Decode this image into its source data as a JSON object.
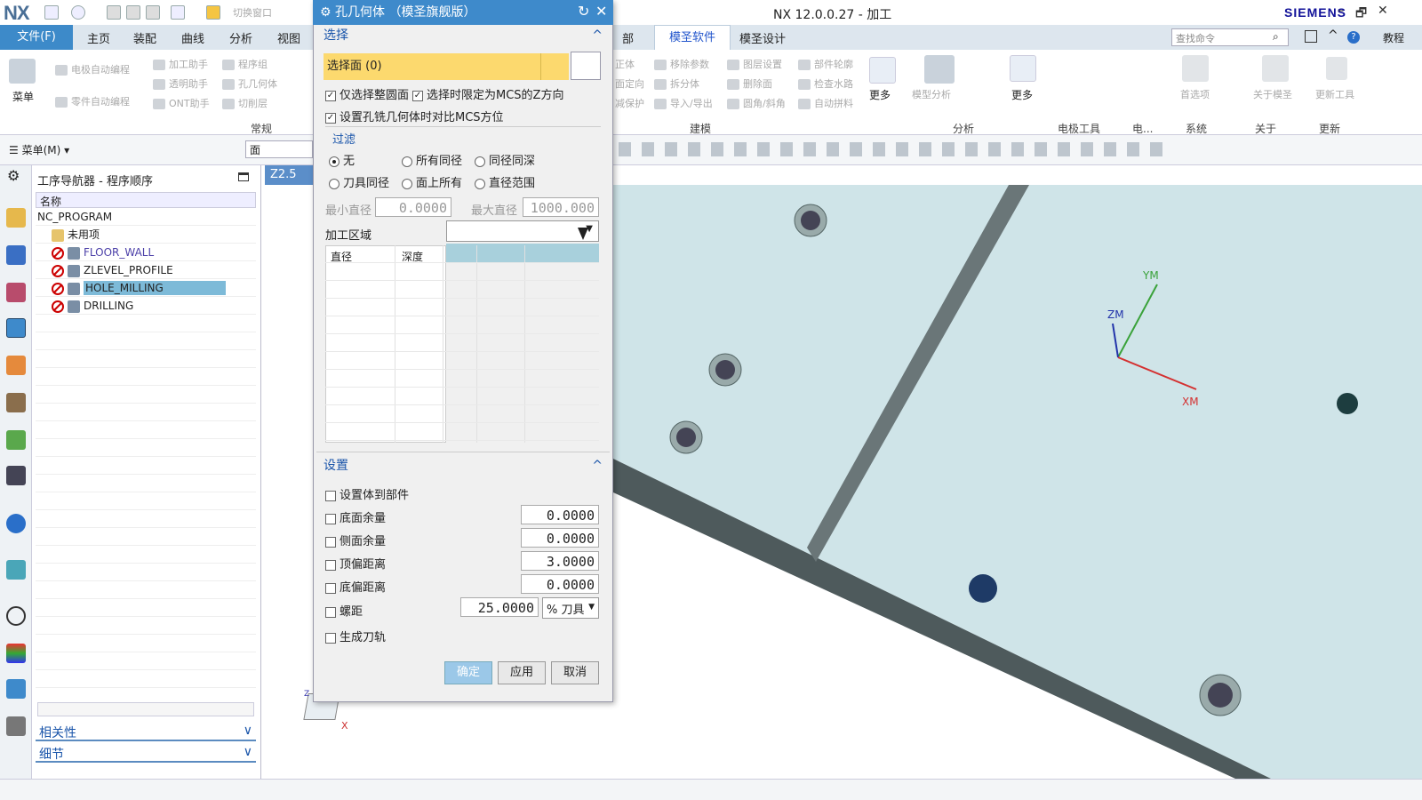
{
  "app": {
    "logo": "NX",
    "title": "NX 12.0.0.27 - 加工",
    "brand": "SIEMENS",
    "win_min": "–",
    "win_restore": "🗗",
    "win_close": "✕",
    "quick_switch": "切换窗口"
  },
  "menubar": {
    "file": "文件(F)",
    "tabs": [
      "主页",
      "装配",
      "曲线",
      "分析",
      "视图"
    ],
    "tabs_right": [
      "部",
      "模圣软件",
      "模圣设计"
    ],
    "search_placeholder": "查找命令",
    "tutorial": "教程"
  },
  "ribbon": {
    "menu_label": "菜单",
    "left_items": [
      "电极自动编程",
      "零件自动编程",
      "加工助手",
      "透明助手",
      "ONT助手",
      "程序组",
      "孔几何体",
      "切削层"
    ],
    "left_group": "常规",
    "model_items": [
      "正体",
      "移除参数",
      "图层设置",
      "部件轮廓",
      "面定向",
      "拆分体",
      "删除面",
      "检查水路",
      "减保护",
      "导入/导出",
      "圆角/斜角",
      "自动拼料"
    ],
    "more1": "更多",
    "model_group": "建模",
    "analysis_items": [
      "模型分析"
    ],
    "more2": "更多",
    "analysis_group": "分析",
    "groups_right": [
      "电极工具",
      "电...",
      "系统",
      "关于",
      "更新"
    ],
    "right_items": [
      "首选项",
      "关于模圣",
      "更新工具"
    ]
  },
  "toolbar2": {
    "menu": "菜单(M)",
    "filter_value": "面"
  },
  "navigator": {
    "title": "工序导航器 - 程序顺序",
    "column": "名称",
    "root": "NC_PROGRAM",
    "items": [
      {
        "name": "未用项"
      },
      {
        "name": "FLOOR_WALL"
      },
      {
        "name": "ZLEVEL_PROFILE"
      },
      {
        "name": "HOLE_MILLING"
      },
      {
        "name": "DRILLING"
      }
    ],
    "sections": [
      "相关性",
      "细节"
    ]
  },
  "graphics_tab": "Z2.5",
  "dialog": {
    "title": "孔几何体 （模圣旗舰版）",
    "select_section": "选择",
    "select_face": "选择面 (0)",
    "opt1": "仅选择整圆面",
    "opt2": "选择时限定为MCS的Z方向",
    "opt3": "设置孔铣几何体时对比MCS方位",
    "filter": "过滤",
    "radios": [
      "无",
      "所有同径",
      "同径同深",
      "刀具同径",
      "面上所有",
      "直径范围"
    ],
    "min_dia_label": "最小直径",
    "min_dia": "0.0000",
    "max_dia_label": "最大直径",
    "max_dia": "1000.000",
    "region_label": "加工区域",
    "table_cols": [
      "直径",
      "深度"
    ],
    "settings_section": "设置",
    "set_body": "设置体到部件",
    "settings": [
      {
        "label": "底面余量",
        "value": "0.0000"
      },
      {
        "label": "侧面余量",
        "value": "0.0000"
      },
      {
        "label": "顶偏距离",
        "value": "3.0000"
      },
      {
        "label": "底偏距离",
        "value": "0.0000"
      }
    ],
    "pitch_label": "螺距",
    "pitch": "25.0000",
    "pitch_unit": "% 刀具",
    "gen_path": "生成刀轨",
    "ok": "确定",
    "apply": "应用",
    "cancel": "取消"
  },
  "viewport": {
    "axes": {
      "y": "YM",
      "z": "ZM",
      "x": "XM"
    },
    "triad_x": "X",
    "triad_z": "Z",
    "surface_color": "#cfe4e8",
    "edge_color": "#4e5a5c"
  }
}
